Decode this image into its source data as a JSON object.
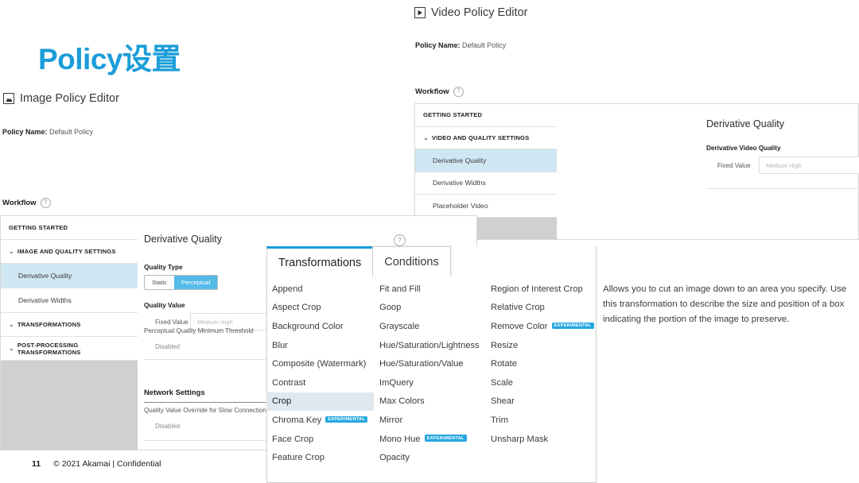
{
  "slide": {
    "title": "Policy设置",
    "title_color": "#1b9dd9",
    "footer_page": "11",
    "footer_text": "© 2021 Akamai | Confidential"
  },
  "image_editor": {
    "icon": "image-icon",
    "title": "Image Policy Editor",
    "policy_label": "Policy Name:",
    "policy_value": "Default Policy",
    "workflow_label": "Workflow",
    "help_icon": "help-icon",
    "nav": [
      {
        "label": "GETTING STARTED",
        "type": "group",
        "chevron": "",
        "selected": false
      },
      {
        "label": "IMAGE AND QUALITY SETTINGS",
        "type": "group",
        "chevron": "⌄",
        "selected": false
      },
      {
        "label": "Derivative Quality",
        "type": "leaf",
        "selected": true
      },
      {
        "label": "Derivative Widths",
        "type": "leaf",
        "selected": false
      },
      {
        "label": "TRANSFORMATIONS",
        "type": "group",
        "chevron": "⌄",
        "selected": false
      },
      {
        "label": "POST-PROCESSING TRANSFORMATIONS",
        "type": "group",
        "chevron": "⌄",
        "selected": false
      }
    ],
    "panel": {
      "title": "Derivative Quality",
      "help_icon": "help-icon",
      "quality_type_label": "Quality Type",
      "quality_type_options": [
        "Static",
        "Perceptual"
      ],
      "quality_type_selected": "Perceptual",
      "quality_value_label": "Quality Value",
      "fixed_value_label": "Fixed Value",
      "fixed_value_placeholder": "Medium High",
      "threshold_label": "Perceptual Quality Minimum Threshold",
      "threshold_value": "Disabled",
      "network_settings_label": "Network Settings",
      "slow_override_label": "Quality Value Override for Slow Connections",
      "slow_override_value": "Disabled"
    }
  },
  "video_editor": {
    "icon": "video-icon",
    "title": "Video Policy Editor",
    "policy_label": "Policy Name:",
    "policy_value": "Default Policy",
    "workflow_label": "Workflow",
    "help_icon": "help-icon",
    "nav": [
      {
        "label": "GETTING STARTED",
        "type": "group",
        "chevron": "",
        "selected": false
      },
      {
        "label": "VIDEO AND QUALITY SETTINGS",
        "type": "group",
        "chevron": "⌄",
        "selected": false
      },
      {
        "label": "Derivative Quality",
        "type": "leaf",
        "selected": true
      },
      {
        "label": "Derivative Widths",
        "type": "leaf",
        "selected": false
      },
      {
        "label": "Placeholder Video",
        "type": "leaf",
        "selected": false
      }
    ],
    "panel": {
      "title": "Derivative Quality",
      "help_icon": "help-icon",
      "quality_label": "Derivative Video Quality",
      "fixed_value_label": "Fixed Value",
      "fixed_value_placeholder": "Medium High"
    }
  },
  "transformations_card": {
    "tabs": [
      {
        "label": "Transformations",
        "active": true
      },
      {
        "label": "Conditions",
        "active": false
      }
    ],
    "selected_item": "Crop",
    "columns": [
      [
        {
          "label": "Append"
        },
        {
          "label": "Aspect Crop"
        },
        {
          "label": "Background Color"
        },
        {
          "label": "Blur"
        },
        {
          "label": "Composite (Watermark)"
        },
        {
          "label": "Contrast"
        },
        {
          "label": "Crop",
          "selected": true
        },
        {
          "label": "Chroma Key",
          "badge": "EXPERIMENTAL"
        },
        {
          "label": "Face Crop"
        },
        {
          "label": "Feature Crop"
        }
      ],
      [
        {
          "label": "Fit and Fill"
        },
        {
          "label": "Goop"
        },
        {
          "label": "Grayscale"
        },
        {
          "label": "Hue/Saturation/Lightness"
        },
        {
          "label": "Hue/Saturation/Value"
        },
        {
          "label": "ImQuery"
        },
        {
          "label": "Max Colors"
        },
        {
          "label": "Mirror"
        },
        {
          "label": "Mono Hue",
          "badge": "EXPERIMENTAL"
        },
        {
          "label": "Opacity"
        }
      ],
      [
        {
          "label": "Region of Interest Crop"
        },
        {
          "label": "Relative Crop"
        },
        {
          "label": "Remove Color",
          "badge": "EXPERIMENTAL"
        },
        {
          "label": "Resize"
        },
        {
          "label": "Rotate"
        },
        {
          "label": "Scale"
        },
        {
          "label": "Shear"
        },
        {
          "label": "Trim"
        },
        {
          "label": "Unsharp Mask"
        }
      ]
    ],
    "description": "Allows you to cut an image down to an area you specify. Use this transformation to describe the size and position of a box indicating the portion of the image to preserve."
  },
  "colors": {
    "accent": "#1b9dd9",
    "toggle_on": "#55bbe8",
    "selected_row": "#cfe7f3",
    "badge": "#25a7e0",
    "nav_empty": "#d0d0d0"
  }
}
